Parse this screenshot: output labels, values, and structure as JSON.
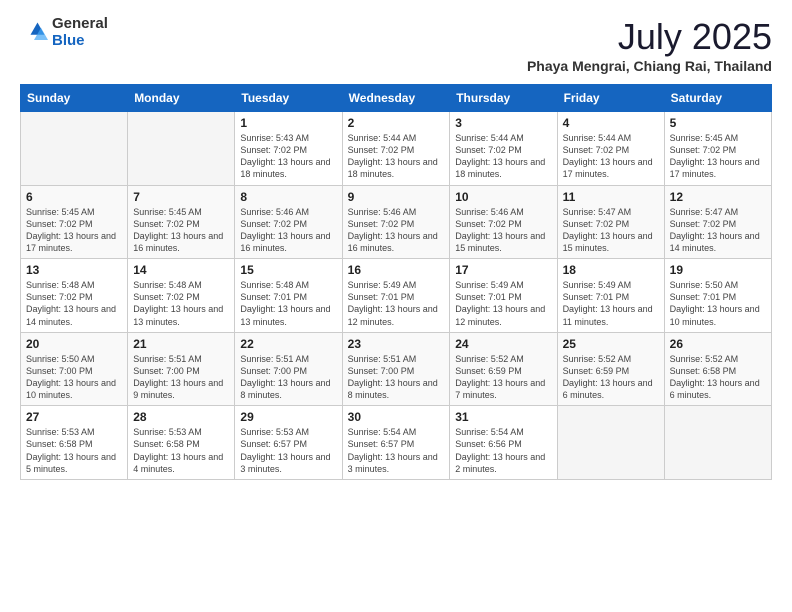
{
  "logo": {
    "general": "General",
    "blue": "Blue"
  },
  "header": {
    "month": "July 2025",
    "location": "Phaya Mengrai, Chiang Rai, Thailand"
  },
  "weekdays": [
    "Sunday",
    "Monday",
    "Tuesday",
    "Wednesday",
    "Thursday",
    "Friday",
    "Saturday"
  ],
  "weeks": [
    [
      {
        "day": "",
        "content": ""
      },
      {
        "day": "",
        "content": ""
      },
      {
        "day": "1",
        "content": "Sunrise: 5:43 AM\nSunset: 7:02 PM\nDaylight: 13 hours and 18 minutes."
      },
      {
        "day": "2",
        "content": "Sunrise: 5:44 AM\nSunset: 7:02 PM\nDaylight: 13 hours and 18 minutes."
      },
      {
        "day": "3",
        "content": "Sunrise: 5:44 AM\nSunset: 7:02 PM\nDaylight: 13 hours and 18 minutes."
      },
      {
        "day": "4",
        "content": "Sunrise: 5:44 AM\nSunset: 7:02 PM\nDaylight: 13 hours and 17 minutes."
      },
      {
        "day": "5",
        "content": "Sunrise: 5:45 AM\nSunset: 7:02 PM\nDaylight: 13 hours and 17 minutes."
      }
    ],
    [
      {
        "day": "6",
        "content": "Sunrise: 5:45 AM\nSunset: 7:02 PM\nDaylight: 13 hours and 17 minutes."
      },
      {
        "day": "7",
        "content": "Sunrise: 5:45 AM\nSunset: 7:02 PM\nDaylight: 13 hours and 16 minutes."
      },
      {
        "day": "8",
        "content": "Sunrise: 5:46 AM\nSunset: 7:02 PM\nDaylight: 13 hours and 16 minutes."
      },
      {
        "day": "9",
        "content": "Sunrise: 5:46 AM\nSunset: 7:02 PM\nDaylight: 13 hours and 16 minutes."
      },
      {
        "day": "10",
        "content": "Sunrise: 5:46 AM\nSunset: 7:02 PM\nDaylight: 13 hours and 15 minutes."
      },
      {
        "day": "11",
        "content": "Sunrise: 5:47 AM\nSunset: 7:02 PM\nDaylight: 13 hours and 15 minutes."
      },
      {
        "day": "12",
        "content": "Sunrise: 5:47 AM\nSunset: 7:02 PM\nDaylight: 13 hours and 14 minutes."
      }
    ],
    [
      {
        "day": "13",
        "content": "Sunrise: 5:48 AM\nSunset: 7:02 PM\nDaylight: 13 hours and 14 minutes."
      },
      {
        "day": "14",
        "content": "Sunrise: 5:48 AM\nSunset: 7:02 PM\nDaylight: 13 hours and 13 minutes."
      },
      {
        "day": "15",
        "content": "Sunrise: 5:48 AM\nSunset: 7:01 PM\nDaylight: 13 hours and 13 minutes."
      },
      {
        "day": "16",
        "content": "Sunrise: 5:49 AM\nSunset: 7:01 PM\nDaylight: 13 hours and 12 minutes."
      },
      {
        "day": "17",
        "content": "Sunrise: 5:49 AM\nSunset: 7:01 PM\nDaylight: 13 hours and 12 minutes."
      },
      {
        "day": "18",
        "content": "Sunrise: 5:49 AM\nSunset: 7:01 PM\nDaylight: 13 hours and 11 minutes."
      },
      {
        "day": "19",
        "content": "Sunrise: 5:50 AM\nSunset: 7:01 PM\nDaylight: 13 hours and 10 minutes."
      }
    ],
    [
      {
        "day": "20",
        "content": "Sunrise: 5:50 AM\nSunset: 7:00 PM\nDaylight: 13 hours and 10 minutes."
      },
      {
        "day": "21",
        "content": "Sunrise: 5:51 AM\nSunset: 7:00 PM\nDaylight: 13 hours and 9 minutes."
      },
      {
        "day": "22",
        "content": "Sunrise: 5:51 AM\nSunset: 7:00 PM\nDaylight: 13 hours and 8 minutes."
      },
      {
        "day": "23",
        "content": "Sunrise: 5:51 AM\nSunset: 7:00 PM\nDaylight: 13 hours and 8 minutes."
      },
      {
        "day": "24",
        "content": "Sunrise: 5:52 AM\nSunset: 6:59 PM\nDaylight: 13 hours and 7 minutes."
      },
      {
        "day": "25",
        "content": "Sunrise: 5:52 AM\nSunset: 6:59 PM\nDaylight: 13 hours and 6 minutes."
      },
      {
        "day": "26",
        "content": "Sunrise: 5:52 AM\nSunset: 6:58 PM\nDaylight: 13 hours and 6 minutes."
      }
    ],
    [
      {
        "day": "27",
        "content": "Sunrise: 5:53 AM\nSunset: 6:58 PM\nDaylight: 13 hours and 5 minutes."
      },
      {
        "day": "28",
        "content": "Sunrise: 5:53 AM\nSunset: 6:58 PM\nDaylight: 13 hours and 4 minutes."
      },
      {
        "day": "29",
        "content": "Sunrise: 5:53 AM\nSunset: 6:57 PM\nDaylight: 13 hours and 3 minutes."
      },
      {
        "day": "30",
        "content": "Sunrise: 5:54 AM\nSunset: 6:57 PM\nDaylight: 13 hours and 3 minutes."
      },
      {
        "day": "31",
        "content": "Sunrise: 5:54 AM\nSunset: 6:56 PM\nDaylight: 13 hours and 2 minutes."
      },
      {
        "day": "",
        "content": ""
      },
      {
        "day": "",
        "content": ""
      }
    ]
  ]
}
